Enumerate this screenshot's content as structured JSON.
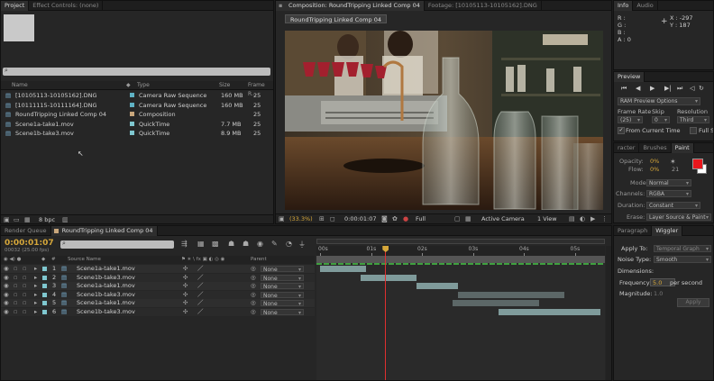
{
  "project": {
    "tabs": [
      "Project",
      "Effect Controls: (none)"
    ],
    "search_placeholder": "",
    "columns": [
      "Name",
      "Type",
      "Size",
      "Frame R..."
    ],
    "items": [
      {
        "name": "[10105113-10105162].DNG",
        "type": "Camera Raw Sequence",
        "size": "160 MB",
        "fr": "25",
        "color": "#5fb2c4",
        "icon": "image-sequence-icon"
      },
      {
        "name": "[10111115-10111164].DNG",
        "type": "Camera Raw Sequence",
        "size": "160 MB",
        "fr": "25",
        "color": "#5fb2c4",
        "icon": "image-sequence-icon"
      },
      {
        "name": "RoundTripping Linked Comp 04",
        "type": "Composition",
        "size": "",
        "fr": "25",
        "color": "#c9a77c",
        "icon": "composition-icon"
      },
      {
        "name": "Scene1a-take1.mov",
        "type": "QuickTime",
        "size": "7.7 MB",
        "fr": "25",
        "color": "#7fc7cf",
        "icon": "footage-icon"
      },
      {
        "name": "Scene1b-take3.mov",
        "type": "QuickTime",
        "size": "8.9 MB",
        "fr": "25",
        "color": "#7fc7cf",
        "icon": "footage-icon"
      }
    ],
    "bpc": "8 bpc"
  },
  "viewer": {
    "tabs": [
      "Composition: RoundTripping Linked Comp 04",
      "Footage: [10105113-10105162].DNG"
    ],
    "comp_name": "RoundTripping Linked Comp 04",
    "zoom": "(33.3%)",
    "timecode": "0:00:01:07",
    "resolution": "Full",
    "camera": "Active Camera",
    "views": "1 View"
  },
  "info": {
    "tabs": [
      "Info",
      "Audio"
    ],
    "r": "R :",
    "g": "G :",
    "b": "B :",
    "a": "A :  0",
    "x": "X : -297",
    "y": "Y : 187"
  },
  "preview": {
    "title": "Preview",
    "ram_options": "RAM Preview Options",
    "frame_rate_label": "Frame Rate",
    "skip_label": "Skip",
    "resolution_label": "Resolution",
    "frame_rate_value": "(25)",
    "skip_value": "0",
    "resolution_value": "Third",
    "from_current": "From Current Time",
    "full_screen": "Full Screen"
  },
  "paint": {
    "tabs": [
      "racter",
      "Brushes",
      "Paint"
    ],
    "opacity_label": "Opacity:",
    "opacity_value": "0%",
    "flow_label": "Flow:",
    "flow_value": "0%",
    "brush_size": "21",
    "mode_label": "Mode:",
    "mode_value": "Normal",
    "channels_label": "Channels:",
    "channels_value": "RGBA",
    "duration_label": "Duration:",
    "duration_value": "Constant",
    "erase_label": "Erase:",
    "erase_value": "Layer Source & Paint",
    "fg_color": "#e8161c"
  },
  "wiggler": {
    "tabs": [
      "Paragraph",
      "Wiggler"
    ],
    "apply_to_label": "Apply To:",
    "apply_to_value": "Temporal Graph",
    "noise_label": "Noise Type:",
    "noise_value": "Smooth",
    "dimensions_label": "Dimensions:",
    "frequency_label": "Frequency:",
    "frequency_value": "5.0",
    "frequency_unit": "per second",
    "magnitude_label": "Magnitude:",
    "magnitude_value": "1.0",
    "apply_button": "Apply"
  },
  "timeline": {
    "tabs": [
      "Render Queue",
      "RoundTripping Linked Comp 04"
    ],
    "timecode": "0:00:01:07",
    "fps": "00032 (25.00 fps)",
    "search_placeholder": "",
    "col_source": "Source Name",
    "col_parent": "Parent",
    "ruler": [
      "00s",
      "01s",
      "02s",
      "03s",
      "04s",
      "05s"
    ],
    "playhead_seconds": 1.28,
    "layers": [
      {
        "num": "1",
        "name": "Scene1a-take1.mov",
        "parent": "None",
        "start": 0.0,
        "end": 0.9,
        "sel": true
      },
      {
        "num": "2",
        "name": "Scene1b-take3.mov",
        "parent": "None",
        "start": 0.8,
        "end": 1.9,
        "sel": true
      },
      {
        "num": "3",
        "name": "Scene1a-take1.mov",
        "parent": "None",
        "start": 1.9,
        "end": 2.7,
        "sel": true
      },
      {
        "num": "4",
        "name": "Scene1b-take3.mov",
        "parent": "None",
        "start": 2.7,
        "end": 4.8,
        "sel": false
      },
      {
        "num": "5",
        "name": "Scene1a-take1.mov",
        "parent": "None",
        "start": 2.6,
        "end": 4.3,
        "sel": false
      },
      {
        "num": "6",
        "name": "Scene1b-take3.mov",
        "parent": "None",
        "start": 3.5,
        "end": 5.5,
        "sel": true
      }
    ]
  }
}
